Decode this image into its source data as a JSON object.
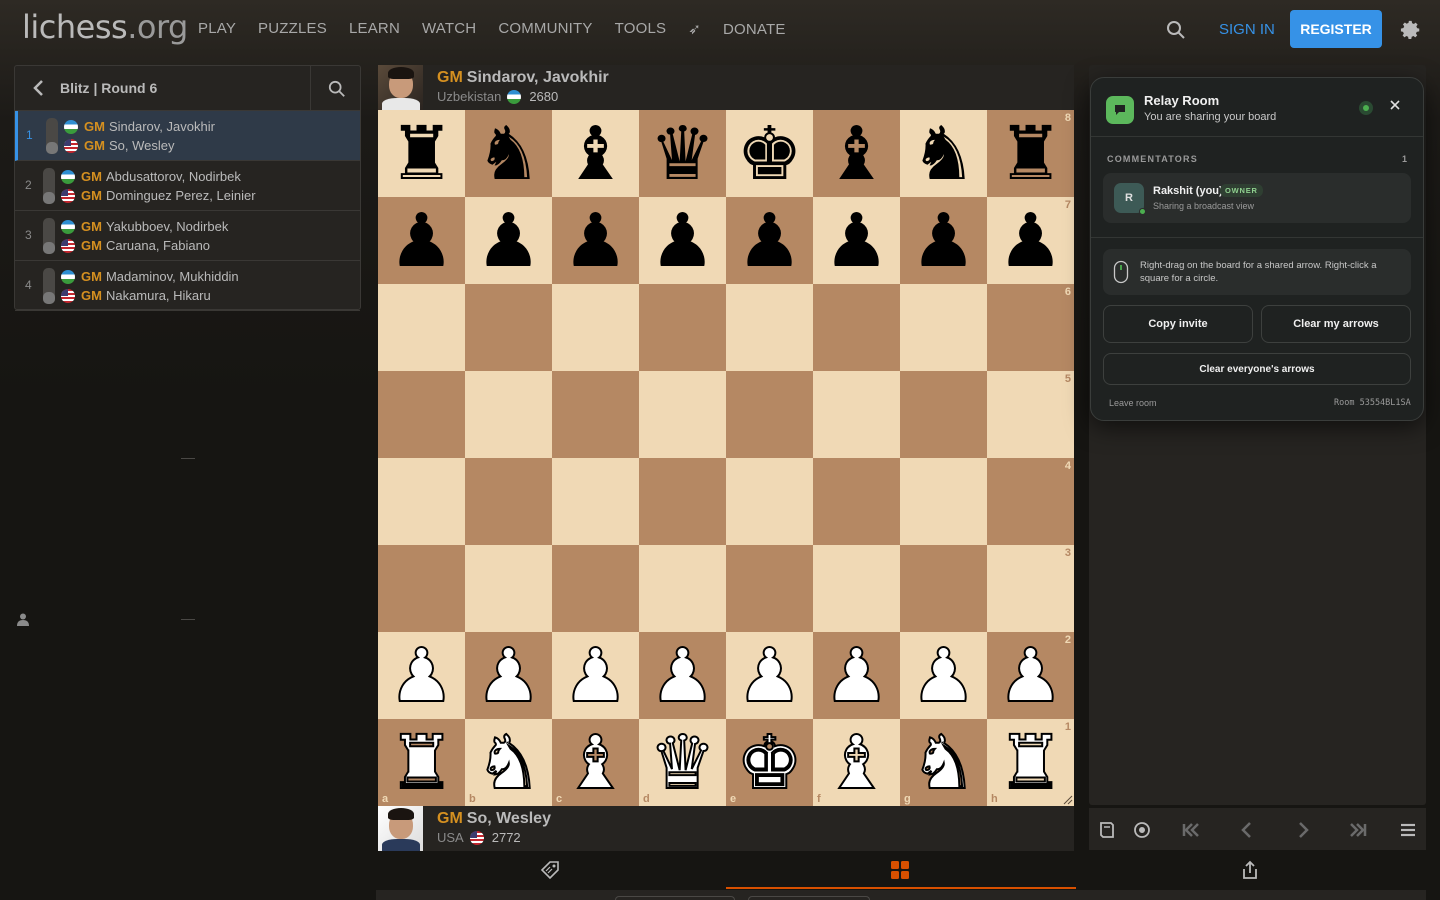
{
  "header": {
    "logo_main": "lichess",
    "logo_tld": ".org",
    "nav": [
      "PLAY",
      "PUZZLES",
      "LEARN",
      "WATCH",
      "COMMUNITY",
      "TOOLS"
    ],
    "donate": "DONATE",
    "sign_in": "SIGN IN",
    "register": "REGISTER"
  },
  "games_panel": {
    "title": "Blitz | Round 6",
    "games": [
      {
        "num": "1",
        "white": {
          "title": "GM",
          "name": "Sindarov, Javokhir",
          "flag": "uz"
        },
        "black": {
          "title": "GM",
          "name": "So, Wesley",
          "flag": "us"
        }
      },
      {
        "num": "2",
        "white": {
          "title": "GM",
          "name": "Abdusattorov, Nodirbek",
          "flag": "uz"
        },
        "black": {
          "title": "GM",
          "name": "Dominguez Perez, Leinier",
          "flag": "us"
        }
      },
      {
        "num": "3",
        "white": {
          "title": "GM",
          "name": "Yakubboev, Nodirbek",
          "flag": "uz"
        },
        "black": {
          "title": "GM",
          "name": "Caruana, Fabiano",
          "flag": "us"
        }
      },
      {
        "num": "4",
        "white": {
          "title": "GM",
          "name": "Madaminov, Mukhiddin",
          "flag": "uz"
        },
        "black": {
          "title": "GM",
          "name": "Nakamura, Hikaru",
          "flag": "us"
        }
      }
    ]
  },
  "top_player": {
    "title": "GM",
    "name": "Sindarov, Javokhir",
    "country": "Uzbekistan",
    "rating": "2680"
  },
  "bottom_player": {
    "title": "GM",
    "name": "So, Wesley",
    "country": "USA",
    "rating": "2772"
  },
  "board": {
    "position": [
      [
        "r",
        "n",
        "b",
        "q",
        "k",
        "b",
        "n",
        "r"
      ],
      [
        "p",
        "p",
        "p",
        "p",
        "p",
        "p",
        "p",
        "p"
      ],
      [
        "",
        "",
        "",
        "",
        "",
        "",
        "",
        ""
      ],
      [
        "",
        "",
        "",
        "",
        "",
        "",
        "",
        ""
      ],
      [
        "",
        "",
        "",
        "",
        "",
        "",
        "",
        ""
      ],
      [
        "",
        "",
        "",
        "",
        "",
        "",
        "",
        ""
      ],
      [
        "P",
        "P",
        "P",
        "P",
        "P",
        "P",
        "P",
        "P"
      ],
      [
        "R",
        "N",
        "B",
        "Q",
        "K",
        "B",
        "N",
        "R"
      ]
    ],
    "ranks": [
      "8",
      "7",
      "6",
      "5",
      "4",
      "3",
      "2",
      "1"
    ],
    "files": [
      "a",
      "b",
      "c",
      "d",
      "e",
      "f",
      "g",
      "h"
    ]
  },
  "relay_room": {
    "title": "Relay Room",
    "subtitle": "You are sharing your board",
    "commentators_label": "COMMENTATORS",
    "commentators_count": "1",
    "commentator": {
      "initial": "R",
      "name": "Rakshit (you)",
      "badge": "OWNER",
      "status": "Sharing a broadcast view"
    },
    "hint": "Right-drag on the board for a shared arrow. Right-click a square for a circle.",
    "copy_invite": "Copy invite",
    "clear_mine": "Clear my arrows",
    "clear_all": "Clear everyone's arrows",
    "leave": "Leave room",
    "room_id": "Room 53554BL1SA"
  },
  "colors": {
    "accent": "#3692e7",
    "donate": "#d59020",
    "title_gm": "#d59020",
    "light_square": "#f0d9b5",
    "dark_square": "#b58863",
    "live": "#4caf50"
  }
}
